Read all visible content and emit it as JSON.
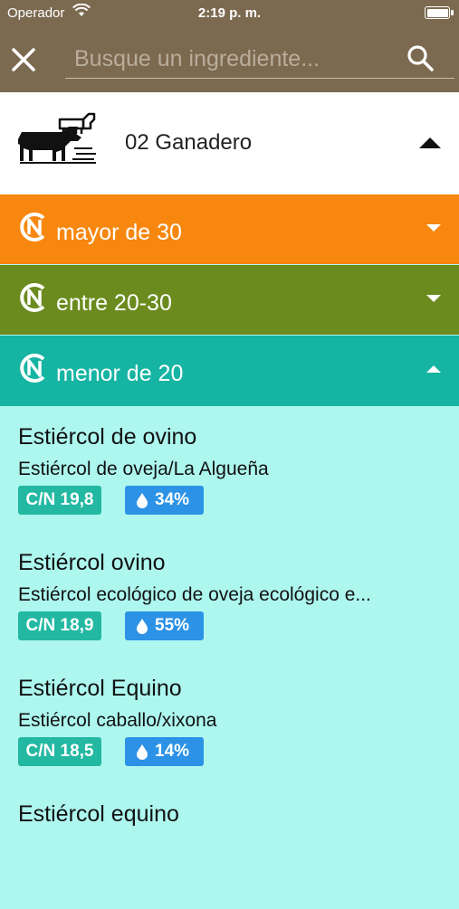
{
  "status": {
    "carrier": "Operador",
    "time": "2:19 p. m."
  },
  "search": {
    "placeholder": "Busque un ingrediente..."
  },
  "category": {
    "label": "02 Ganadero"
  },
  "groups": [
    {
      "label": "mayor de 30",
      "color": "#f7870f"
    },
    {
      "label": "entre 20-30",
      "color": "#6b8b1e"
    },
    {
      "label": "menor de 20",
      "color": "#16b4a2"
    }
  ],
  "items": [
    {
      "name": "Estiércol de ovino",
      "desc": "Estiércol de oveja/La Algueña",
      "cn": "C/N 19,8",
      "water": "34%"
    },
    {
      "name": "Estiércol ovino",
      "desc": "Estiércol ecológico de oveja ecológico e...",
      "cn": "C/N 18,9",
      "water": "55%"
    },
    {
      "name": "Estiércol Equino",
      "desc": "Estiércol caballo/xixona",
      "cn": "C/N 18,5",
      "water": "14%"
    },
    {
      "name": "Estiércol equino",
      "desc": "",
      "cn": "",
      "water": ""
    }
  ]
}
